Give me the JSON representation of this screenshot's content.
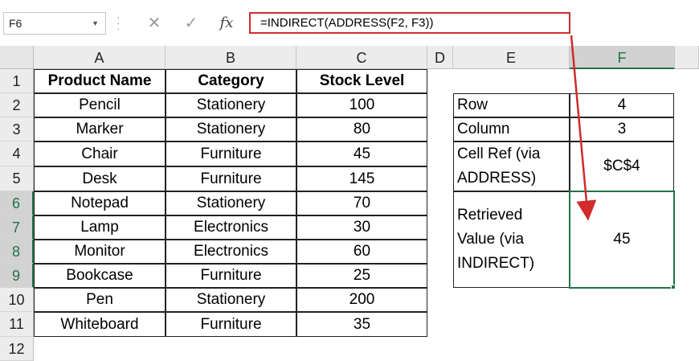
{
  "formula_bar": {
    "name_box": "F6",
    "formula": "=INDIRECT(ADDRESS(F2, F3))",
    "cancel_icon": "close-icon",
    "enter_icon": "check-icon",
    "fx_label": "fx"
  },
  "columns": [
    "A",
    "B",
    "C",
    "D",
    "E",
    "F"
  ],
  "rows": [
    "1",
    "2",
    "3",
    "4",
    "5",
    "6",
    "7",
    "8",
    "9",
    "10",
    "11",
    "12"
  ],
  "table": {
    "headers": [
      "Product Name",
      "Category",
      "Stock Level"
    ],
    "data": [
      [
        "Pencil",
        "Stationery",
        "100"
      ],
      [
        "Marker",
        "Stationery",
        "80"
      ],
      [
        "Chair",
        "Furniture",
        "45"
      ],
      [
        "Desk",
        "Furniture",
        "145"
      ],
      [
        "Notepad",
        "Stationery",
        "70"
      ],
      [
        "Lamp",
        "Electronics",
        "30"
      ],
      [
        "Monitor",
        "Electronics",
        "60"
      ],
      [
        "Bookcase",
        "Furniture",
        "25"
      ],
      [
        "Pen",
        "Stationery",
        "200"
      ],
      [
        "Whiteboard",
        "Furniture",
        "35"
      ]
    ]
  },
  "side_table": {
    "row_label": "Row",
    "row_value": "4",
    "column_label": "Column",
    "column_value": "3",
    "cellref_label_1": "Cell Ref (via",
    "cellref_label_2": "ADDRESS)",
    "cellref_value": "$C$4",
    "retrieved_label_1": "Retrieved",
    "retrieved_label_2": "Value (via",
    "retrieved_label_3": "INDIRECT)",
    "retrieved_value": "45"
  },
  "selection": {
    "active_cell": "F6",
    "accent_color": "#217346"
  },
  "annotation": {
    "highlight_color": "#d12b2b"
  }
}
